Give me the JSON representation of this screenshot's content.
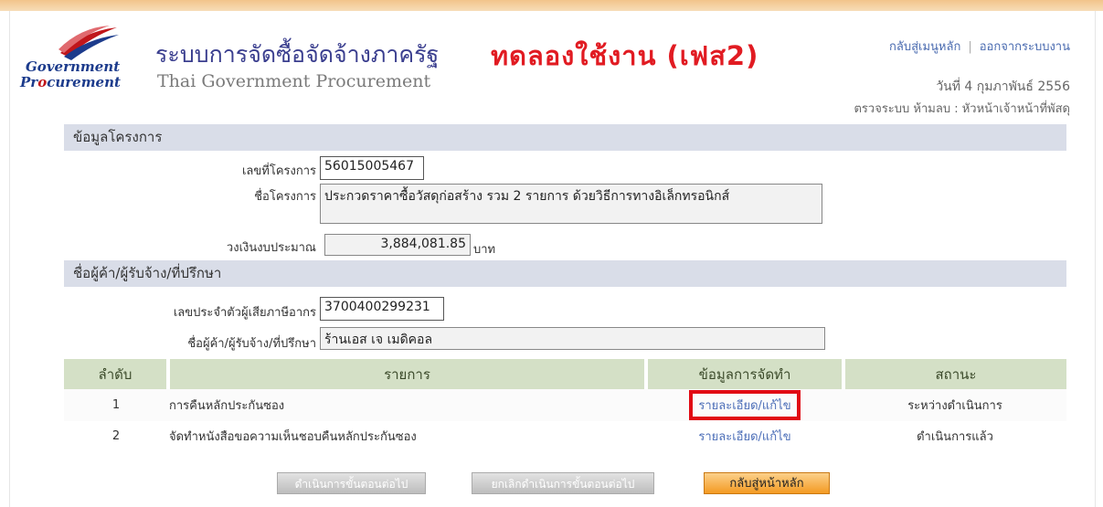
{
  "header": {
    "logo_line1": "Government",
    "logo_line2_prefix": "Pr",
    "logo_line2_o": "o",
    "logo_line2_rest": "curement",
    "system_title": "ระบบการจัดซื้อจัดจ้างภาครัฐ",
    "demo_label": "ทดลองใช้งาน (เฟส2)",
    "subtitle": "Thai Government Procurement",
    "links": {
      "home": "กลับสู่เมนูหลัก",
      "logout": "ออกจากระบบงาน"
    },
    "date": "วันที่ 4 กุมภาพันธ์ 2556",
    "user": "ตรวจระบบ ห้ามลบ : หัวหน้าเจ้าหน้าที่พัสดุ"
  },
  "project": {
    "section_title": "ข้อมูลโครงการ",
    "no_label": "เลขที่โครงการ",
    "no_value": "56015005467",
    "name_label": "ชื่อโครงการ",
    "name_value": "ประกวดราคาซื้อวัสดุก่อสร้าง รวม 2 รายการ ด้วยวิธีการทางอิเล็กทรอนิกส์",
    "budget_label": "วงเงินงบประมาณ",
    "budget_value": "3,884,081.85",
    "budget_unit": "บาท"
  },
  "vendor": {
    "section_title": "ชื่อผู้ค้า/ผู้รับจ้าง/ที่ปรึกษา",
    "tax_label": "เลขประจำตัวผู้เสียภาษีอากร",
    "tax_value": "3700400299231",
    "name_label": "ชื่อผู้ค้า/ผู้รับจ้าง/ที่ปรึกษา",
    "name_value": "ร้านเอส เจ เมดิคอล"
  },
  "table": {
    "headers": [
      "ลำดับ",
      "รายการ",
      "ข้อมูลการจัดทำ",
      "สถานะ"
    ],
    "rows": [
      {
        "no": "1",
        "item": "การคืนหลักประกันซอง",
        "action": "รายละเอียด/แก้ไข",
        "status": "ระหว่างดำเนินการ"
      },
      {
        "no": "2",
        "item": "จัดทำหนังสือขอความเห็นชอบคืนหลักประกันซอง",
        "action": "รายละเอียด/แก้ไข",
        "status": "ดำเนินการแล้ว"
      }
    ]
  },
  "buttons": {
    "next": "ดำเนินการขั้นตอนต่อไป",
    "cancel_next": "ยกเลิกดำเนินการขั้นตอนต่อไป",
    "home": "กลับสู่หน้าหลัก"
  },
  "colors": {
    "accent": "#f39a23",
    "highlight": "#e10a14",
    "demo": "#e11b22",
    "link": "#4d6fb8"
  }
}
